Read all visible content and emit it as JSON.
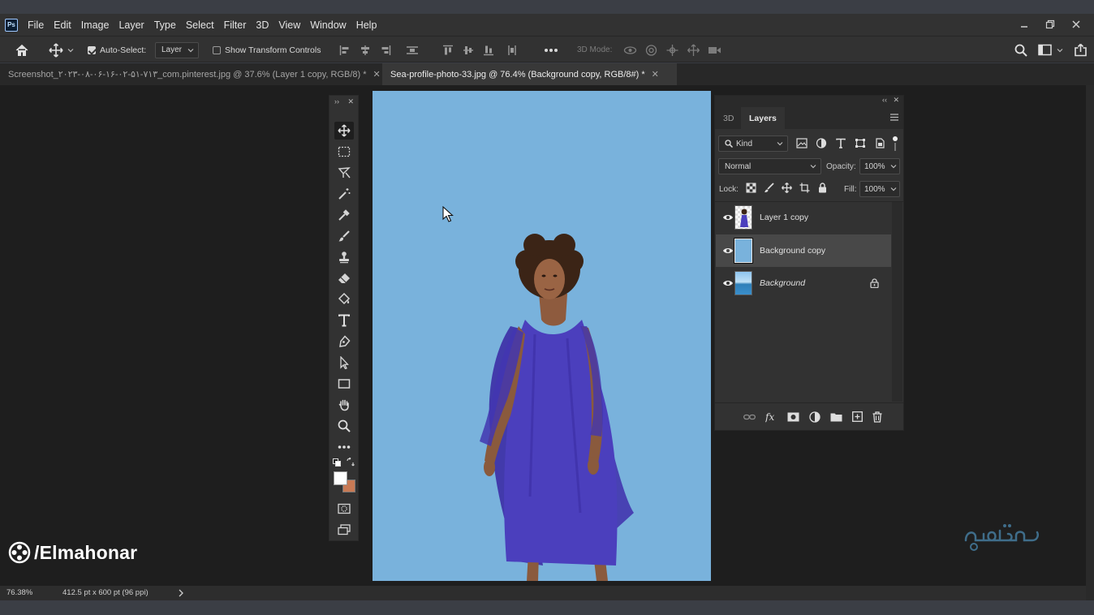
{
  "app": {
    "logo_text": "Ps"
  },
  "menu": [
    "File",
    "Edit",
    "Image",
    "Layer",
    "Type",
    "Select",
    "Filter",
    "3D",
    "View",
    "Window",
    "Help"
  ],
  "options_bar": {
    "auto_select_label": "Auto-Select:",
    "auto_select_checked": true,
    "auto_select_target": "Layer",
    "show_transform_label": "Show Transform Controls",
    "show_transform_checked": false,
    "mode_3d_label": "3D Mode:"
  },
  "tabs": [
    {
      "title": "Screenshot_۲۰۲۳-۰۸-۰۶-۱۶-۰۲-۵۱-۷۱۳_com.pinterest.jpg @ 37.6% (Layer 1 copy, RGB/8) *",
      "active": false
    },
    {
      "title": "Sea-profile-photo-33.jpg @ 76.4% (Background copy, RGB/8#) *",
      "active": true
    }
  ],
  "layers_panel": {
    "tab_3d": "3D",
    "tab_layers": "Layers",
    "filter_kind": "Kind",
    "blend_mode": "Normal",
    "opacity_label": "Opacity:",
    "opacity_value": "100%",
    "lock_label": "Lock:",
    "fill_label": "Fill:",
    "fill_value": "100%",
    "layers": [
      {
        "name": "Layer 1 copy",
        "visible": true,
        "selected": false,
        "locked": false
      },
      {
        "name": "Background copy",
        "visible": true,
        "selected": true,
        "locked": false
      },
      {
        "name": "Background",
        "visible": true,
        "selected": false,
        "locked": true
      }
    ]
  },
  "status_bar": {
    "zoom": "76.38%",
    "doc_size": "412.5 pt x 600 pt (96 ppi)"
  },
  "watermark": {
    "text": "/Elmahonar"
  },
  "colors": {
    "foreground": "#ffffff",
    "background": "#c87a55",
    "canvas_bg": "#79b2dc",
    "dress": "#4b3fbd"
  }
}
